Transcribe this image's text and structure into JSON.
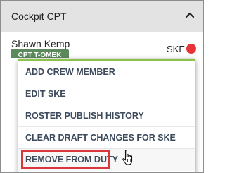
{
  "panel": {
    "title": "Cockpit CPT",
    "collapse_icon": "chevron-up-icon"
  },
  "crew": {
    "name": "Shawn Kemp",
    "badge": "CPT T-OMEK",
    "code": "SKE",
    "status_color": "#e8333a",
    "badge_color": "#5c8a5c"
  },
  "menu": {
    "accent_color": "#8bc34a",
    "items": [
      {
        "label": "ADD CREW MEMBER"
      },
      {
        "label": "EDIT SKE"
      },
      {
        "label": "ROSTER PUBLISH HISTORY"
      },
      {
        "label": "CLEAR DRAFT CHANGES FOR SKE"
      },
      {
        "label": "REMOVE FROM DUTY"
      }
    ],
    "highlight_color": "#d9363e"
  },
  "cursor": "hand-pointer-icon"
}
